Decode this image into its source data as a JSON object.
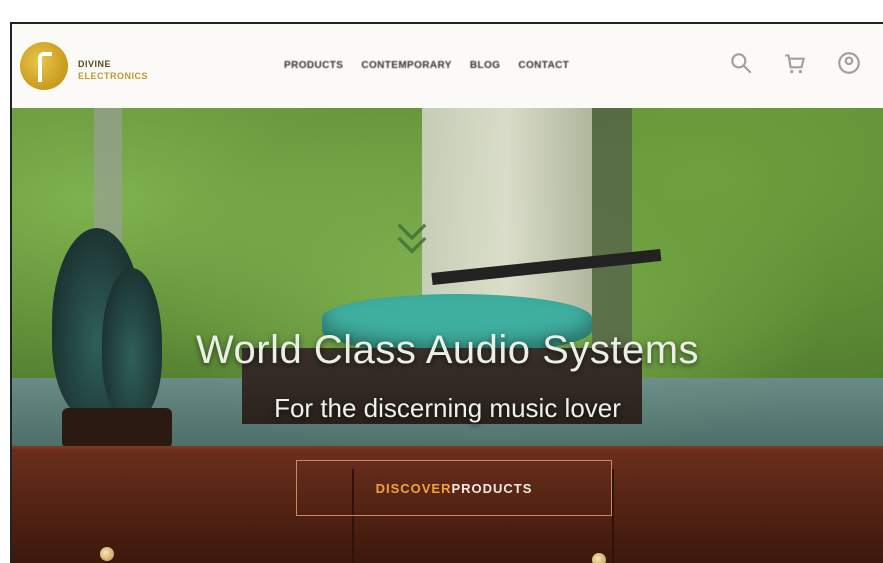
{
  "header": {
    "brand_line1": "DIVINE",
    "brand_line2": "ELECTRONICS",
    "nav": [
      "PRODUCTS",
      "CONTEMPORARY",
      "BLOG",
      "CONTACT"
    ]
  },
  "icons": [
    "search-icon",
    "cart-icon",
    "user-icon"
  ],
  "hero": {
    "headline": "World Class Audio Systems",
    "subline": "For the discerning music lover",
    "cta_part1": "DISCOVER",
    "cta_part2": " PRODUCTS"
  },
  "colors": {
    "brand_gold": "#c89a1e",
    "cta_border": "#c78b63",
    "cta_accent": "#f2a23a",
    "header_bg": "#fbfaf7"
  }
}
